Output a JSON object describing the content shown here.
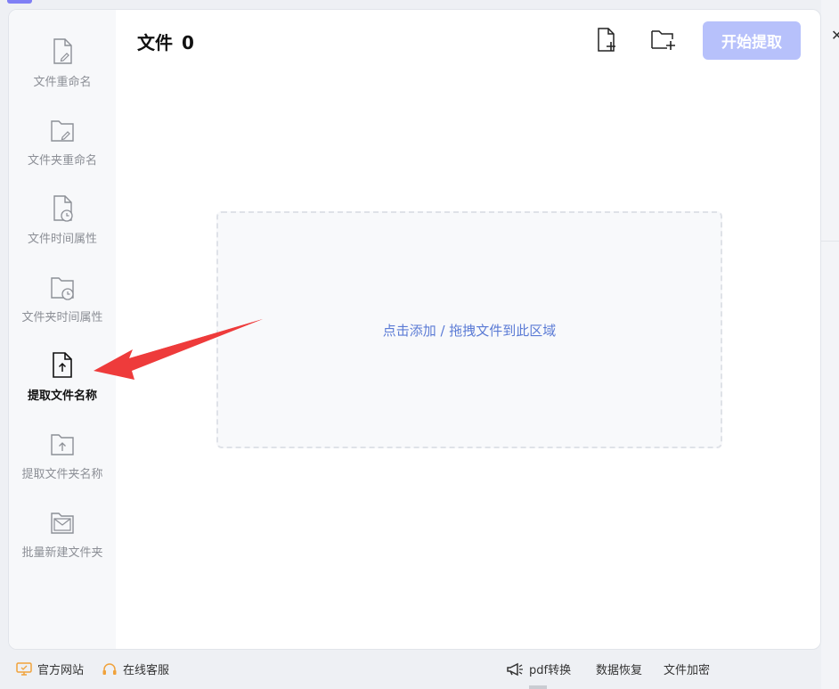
{
  "header": {
    "title": "文件",
    "count": "0",
    "start_button": "开始提取"
  },
  "sidebar": {
    "items": [
      {
        "label": "文件重命名",
        "icon": "file-edit-icon",
        "active": false
      },
      {
        "label": "文件夹重命名",
        "icon": "folder-edit-icon",
        "active": false
      },
      {
        "label": "文件时间属性",
        "icon": "file-clock-icon",
        "active": false
      },
      {
        "label": "文件夹时间属性",
        "icon": "folder-clock-icon",
        "active": false
      },
      {
        "label": "提取文件名称",
        "icon": "file-upload-icon",
        "active": true
      },
      {
        "label": "提取文件夹名称",
        "icon": "folder-upload-icon",
        "active": false
      },
      {
        "label": "批量新建文件夹",
        "icon": "folder-mail-icon",
        "active": false
      }
    ]
  },
  "dropzone": {
    "text": "点击添加 / 拖拽文件到此区域"
  },
  "footer": {
    "website": "官方网站",
    "support": "在线客服",
    "pdf": "pdf转换",
    "recovery": "数据恢复",
    "encrypt": "文件加密"
  },
  "colors": {
    "accent": "#b7c1fb",
    "link": "#5b7bd5",
    "arrow": "#ee3b3b"
  }
}
